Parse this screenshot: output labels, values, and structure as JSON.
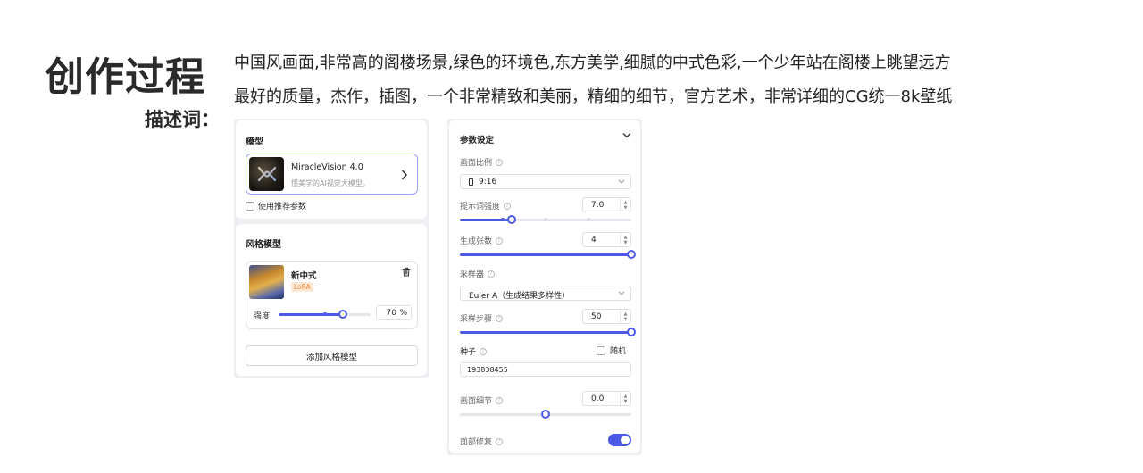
{
  "header": {
    "title": "创作过程",
    "subtitle": "描述词：",
    "prompt_line1": "中国风画面,非常高的阁楼场景,绿色的环境色,东方美学,细腻的中式色彩,一个少年站在阁楼上眺望远方",
    "prompt_line2": "最好的质量，杰作，插图，一个非常精致和美丽，精细的细节，官方艺术，非常详细的CG统一8k壁纸"
  },
  "model_card": {
    "title": "模型",
    "model_name": "MiracleVision 4.0",
    "model_desc": "懂美学的AI视觉大模型。",
    "use_recommended_label": "使用推荐参数",
    "use_recommended_checked": false
  },
  "style_card": {
    "title": "风格模型",
    "lora_name": "新中式",
    "lora_tag": "LoRA",
    "strength_label": "强度",
    "strength_value": "70",
    "strength_unit": "%",
    "strength_fraction": 0.7,
    "add_button_label": "添加风格模型"
  },
  "params": {
    "title": "参数设定",
    "aspect_ratio_label": "画面比例",
    "aspect_ratio_value": "9:16",
    "prompt_strength_label": "提示词强度",
    "prompt_strength_value": "7.0",
    "prompt_strength_fraction": 0.3,
    "count_label": "生成张数",
    "count_value": "4",
    "count_fraction": 1.0,
    "sampler_label": "采样器",
    "sampler_value": "Euler A（生成结果多样性）",
    "steps_label": "采样步骤",
    "steps_value": "50",
    "steps_fraction": 1.0,
    "seed_label": "种子",
    "seed_random_label": "随机",
    "seed_random_checked": false,
    "seed_value": "193838455",
    "detail_label": "画面细节",
    "detail_value": "0.0",
    "detail_fraction": 0.5,
    "face_fix_label": "面部修复",
    "face_fix_on": true
  },
  "colors": {
    "accent": "#4d5ae6",
    "lora_tag_text": "#e8893a",
    "lora_tag_bg": "#fde9d6"
  },
  "icons": {
    "model_arrow": "chevron-right-icon",
    "trash": "trash-icon",
    "collapse": "chevron-down-icon",
    "help": "question-circle-icon"
  }
}
